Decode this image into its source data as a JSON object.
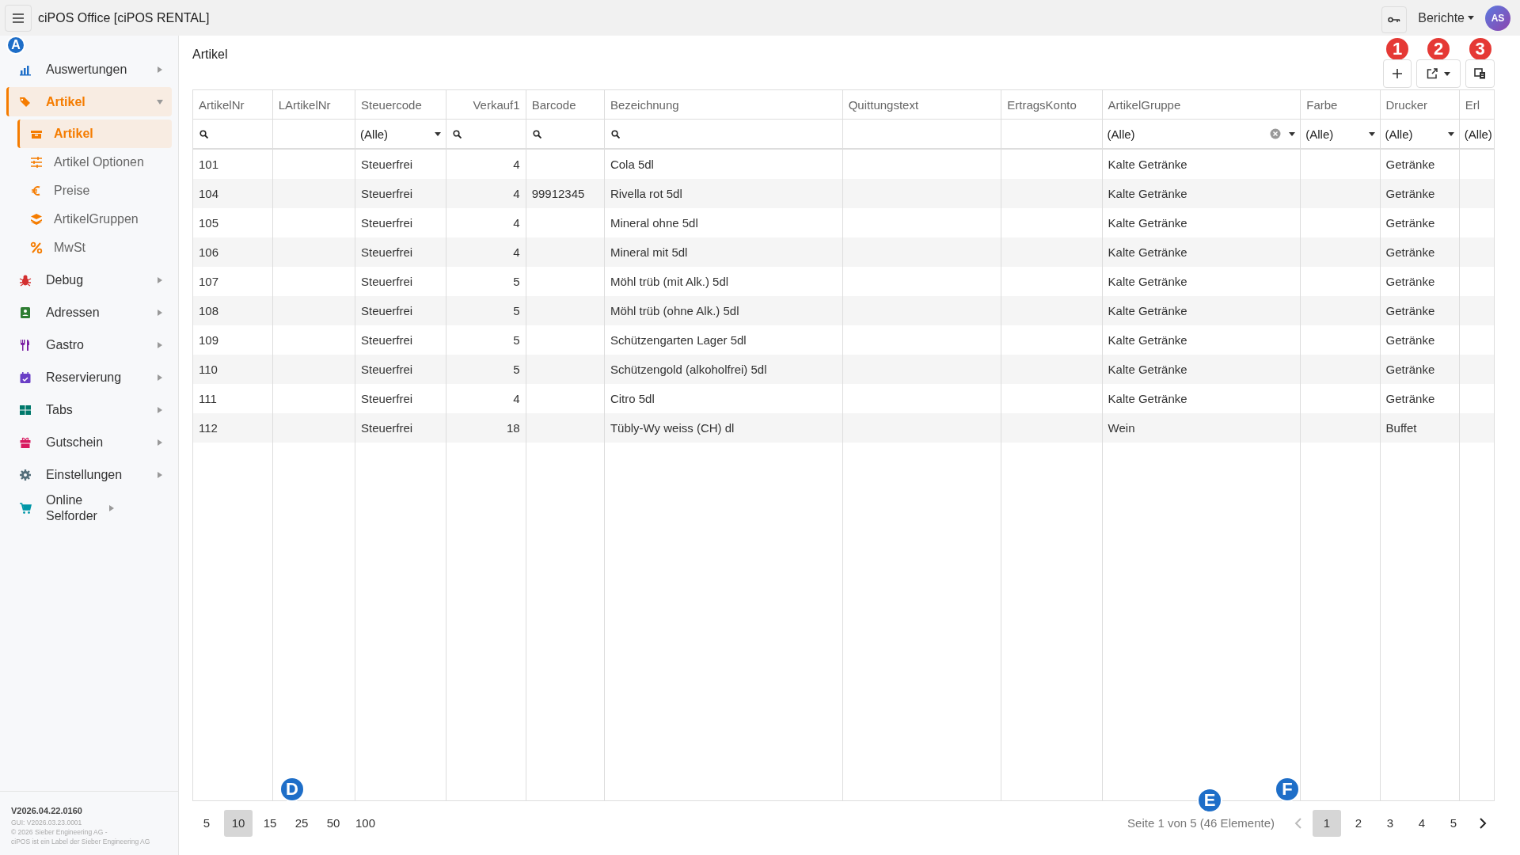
{
  "app": {
    "title": "ciPOS Office [ciPOS RENTAL]"
  },
  "header": {
    "reports": "Berichte",
    "avatar": "AS"
  },
  "sidebar": {
    "items": [
      {
        "label": "Auswertungen",
        "expanded": false,
        "selected": false,
        "callout": {
          "label": "A",
          "kind": "letter"
        }
      },
      {
        "label": "Artikel",
        "expanded": true,
        "selected": true,
        "children": [
          {
            "label": "Artikel",
            "selected": true
          },
          {
            "label": "Artikel Optionen",
            "selected": false
          },
          {
            "label": "Preise",
            "selected": false
          },
          {
            "label": "ArtikelGruppen",
            "selected": false
          },
          {
            "label": "MwSt",
            "selected": false
          }
        ]
      },
      {
        "label": "Debug",
        "expanded": false,
        "selected": false
      },
      {
        "label": "Adressen",
        "expanded": false,
        "selected": false
      },
      {
        "label": "Gastro",
        "expanded": false,
        "selected": false
      },
      {
        "label": "Reservierung",
        "expanded": false,
        "selected": false
      },
      {
        "label": "Tabs",
        "expanded": false,
        "selected": false
      },
      {
        "label": "Gutschein",
        "expanded": false,
        "selected": false
      },
      {
        "label": "Einstellungen",
        "expanded": false,
        "selected": false
      },
      {
        "label": "Online Selforder",
        "expanded": false,
        "selected": false
      }
    ],
    "footer": {
      "version": "V2026.04.22.0160",
      "lines": [
        "GUI: V2026.03.23.0001",
        "© 2026 Sieber Engineering AG -",
        "ciPOS ist ein Label der Sieber Engineering AG"
      ]
    }
  },
  "page": {
    "breadcrumb": "Artikel",
    "toolbar": [
      {
        "kind": "add",
        "callout": {
          "label": "1",
          "kind": "number"
        }
      },
      {
        "kind": "export",
        "callout": {
          "label": "2",
          "kind": "number"
        }
      },
      {
        "kind": "columns",
        "callout": {
          "label": "3",
          "kind": "number"
        }
      }
    ]
  },
  "table": {
    "columns": [
      {
        "label": "ArtikelNr",
        "kind": "search"
      },
      {
        "label": "LArtikelNr",
        "kind": "plain"
      },
      {
        "label": "Steuercode",
        "kind": "select",
        "value": "(Alle)"
      },
      {
        "label": "Verkauf1",
        "kind": "search",
        "right_aligned": true
      },
      {
        "label": "Barcode",
        "kind": "search"
      },
      {
        "label": "Bezeichnung",
        "kind": "search"
      },
      {
        "label": "Quittungstext",
        "kind": "plain"
      },
      {
        "label": "ErtragsKonto",
        "kind": "plain"
      },
      {
        "label": "ArtikelGruppe",
        "kind": "select",
        "value": "(Alle)",
        "clearable": true
      },
      {
        "label": "Farbe",
        "kind": "select",
        "value": "(Alle)"
      },
      {
        "label": "Drucker",
        "kind": "select",
        "value": "(Alle)"
      },
      {
        "label": "Erl",
        "kind": "select",
        "value": "(Alle)"
      }
    ],
    "rows": [
      [
        "101",
        "",
        "Steuerfrei",
        "4",
        "",
        "Cola 5dl",
        "",
        "",
        "Kalte Getränke",
        "",
        "Getränke",
        ""
      ],
      [
        "104",
        "",
        "Steuerfrei",
        "4",
        "99912345",
        "Rivella rot 5dl",
        "",
        "",
        "Kalte Getränke",
        "",
        "Getränke",
        ""
      ],
      [
        "105",
        "",
        "Steuerfrei",
        "4",
        "",
        "Mineral ohne 5dl",
        "",
        "",
        "Kalte Getränke",
        "",
        "Getränke",
        ""
      ],
      [
        "106",
        "",
        "Steuerfrei",
        "4",
        "",
        "Mineral mit 5dl",
        "",
        "",
        "Kalte Getränke",
        "",
        "Getränke",
        ""
      ],
      [
        "107",
        "",
        "Steuerfrei",
        "5",
        "",
        "Möhl trüb (mit Alk.) 5dl",
        "",
        "",
        "Kalte Getränke",
        "",
        "Getränke",
        ""
      ],
      [
        "108",
        "",
        "Steuerfrei",
        "5",
        "",
        "Möhl trüb (ohne Alk.) 5dl",
        "",
        "",
        "Kalte Getränke",
        "",
        "Getränke",
        ""
      ],
      [
        "109",
        "",
        "Steuerfrei",
        "5",
        "",
        "Schützengarten Lager 5dl",
        "",
        "",
        "Kalte Getränke",
        "",
        "Getränke",
        ""
      ],
      [
        "110",
        "",
        "Steuerfrei",
        "5",
        "",
        "Schützengold (alkoholfrei) 5dl",
        "",
        "",
        "Kalte Getränke",
        "",
        "Getränke",
        ""
      ],
      [
        "111",
        "",
        "Steuerfrei",
        "4",
        "",
        "Citro 5dl",
        "",
        "",
        "Kalte Getränke",
        "",
        "Getränke",
        ""
      ],
      [
        "112",
        "",
        "Steuerfrei",
        "18",
        "",
        "Tübly-Wy weiss (CH) dl",
        "",
        "",
        "Wein",
        "",
        "Buffet",
        ""
      ]
    ]
  },
  "pager": {
    "sizes": [
      {
        "label": "5",
        "selected": false
      },
      {
        "label": "10",
        "selected": true
      },
      {
        "label": "15",
        "selected": false
      },
      {
        "label": "25",
        "selected": false
      },
      {
        "label": "50",
        "selected": false
      },
      {
        "label": "100",
        "selected": false
      }
    ],
    "sizes_callout": {
      "label": "D",
      "kind": "letter"
    },
    "info": "Seite 1 von 5 (46 Elemente)",
    "info_callout": {
      "label": "E",
      "kind": "letter"
    },
    "prev_disabled": true,
    "next_disabled": false,
    "pages": [
      {
        "label": "1",
        "selected": true
      },
      {
        "label": "2",
        "selected": false
      },
      {
        "label": "3",
        "selected": false
      },
      {
        "label": "4",
        "selected": false
      },
      {
        "label": "5",
        "selected": false
      }
    ],
    "pages_callout": {
      "label": "F",
      "kind": "letter"
    }
  }
}
